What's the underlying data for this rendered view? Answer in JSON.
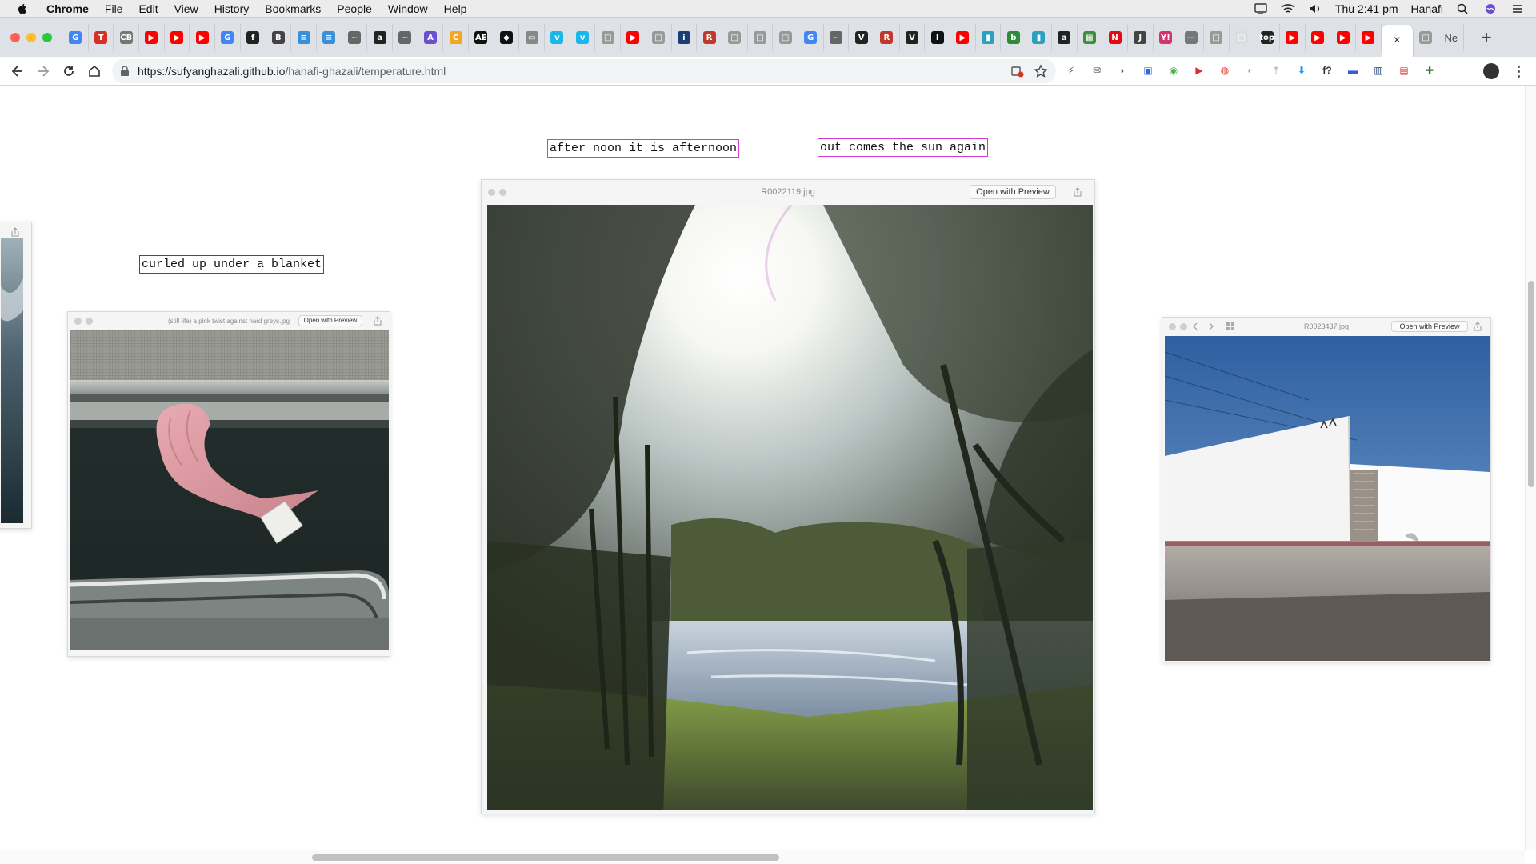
{
  "menubar": {
    "app_name": "Chrome",
    "items": [
      "File",
      "Edit",
      "View",
      "History",
      "Bookmarks",
      "People",
      "Window",
      "Help"
    ],
    "clock": "Thu 2:41 pm",
    "user": "Hanafi"
  },
  "tabs": {
    "favicons": [
      {
        "glyph": "G",
        "color": "#4285f4"
      },
      {
        "glyph": "T",
        "color": "#d93025"
      },
      {
        "glyph": "CB",
        "color": "#777777"
      },
      {
        "glyph": "▶",
        "color": "#ff0000"
      },
      {
        "glyph": "▶",
        "color": "#ff0000"
      },
      {
        "glyph": "▶",
        "color": "#ff0000"
      },
      {
        "glyph": "G",
        "color": "#4285f4"
      },
      {
        "glyph": "f",
        "color": "#222222"
      },
      {
        "glyph": "B",
        "color": "#444444"
      },
      {
        "glyph": "≡",
        "color": "#3a8fd9"
      },
      {
        "glyph": "≡",
        "color": "#3a8fd9"
      },
      {
        "glyph": "~",
        "color": "#666666"
      },
      {
        "glyph": "a",
        "color": "#222222"
      },
      {
        "glyph": "~",
        "color": "#666666"
      },
      {
        "glyph": "A",
        "color": "#6a4fd1"
      },
      {
        "glyph": "C",
        "color": "#f5a623"
      },
      {
        "glyph": "AE",
        "color": "#111111"
      },
      {
        "glyph": "◆",
        "color": "#111111"
      },
      {
        "glyph": "▭",
        "color": "#888888"
      },
      {
        "glyph": "v",
        "color": "#1ab7ea"
      },
      {
        "glyph": "v",
        "color": "#1ab7ea"
      },
      {
        "glyph": "□",
        "color": "#999999"
      },
      {
        "glyph": "▶",
        "color": "#ff0000"
      },
      {
        "glyph": "□",
        "color": "#999999"
      },
      {
        "glyph": "i",
        "color": "#1a3e72"
      },
      {
        "glyph": "R",
        "color": "#c0392b"
      },
      {
        "glyph": "□",
        "color": "#999999"
      },
      {
        "glyph": "□",
        "color": "#999999"
      },
      {
        "glyph": "□",
        "color": "#999999"
      },
      {
        "glyph": "G",
        "color": "#4285f4"
      },
      {
        "glyph": "~",
        "color": "#666666"
      },
      {
        "glyph": "V",
        "color": "#222222"
      },
      {
        "glyph": "R",
        "color": "#c0392b"
      },
      {
        "glyph": "V",
        "color": "#222222"
      },
      {
        "glyph": "I",
        "color": "#111111"
      },
      {
        "glyph": "▶",
        "color": "#ff0000"
      },
      {
        "glyph": "▮",
        "color": "#2aa1c0"
      },
      {
        "glyph": "b",
        "color": "#2e8b3a"
      },
      {
        "glyph": "▮",
        "color": "#2aa1c0"
      },
      {
        "glyph": "a",
        "color": "#222222"
      },
      {
        "glyph": "▦",
        "color": "#3c8d3c"
      },
      {
        "glyph": "N",
        "color": "#e50914"
      },
      {
        "glyph": "J",
        "color": "#444444"
      },
      {
        "glyph": "Y!",
        "color": "#d6336c"
      },
      {
        "glyph": "—",
        "color": "#777777"
      },
      {
        "glyph": "□",
        "color": "#999999"
      },
      {
        "glyph": "□",
        "color": "#dddddd"
      },
      {
        "glyph": "top",
        "color": "#222222"
      },
      {
        "glyph": "▶",
        "color": "#ff0000"
      },
      {
        "glyph": "▶",
        "color": "#ff0000"
      },
      {
        "glyph": "▶",
        "color": "#ff0000"
      },
      {
        "glyph": "▶",
        "color": "#ff0000"
      }
    ],
    "active_close": "×",
    "after_active": [
      {
        "glyph": "□",
        "color": "#999999"
      }
    ],
    "last_tab_title": "Ne",
    "new_tab": "+"
  },
  "toolbar": {
    "url_host": "https://sufyanghazali.github.io",
    "url_path": "/hanafi-ghazali/temperature.html",
    "extensions": [
      {
        "glyph": "⚡",
        "color": "#444444"
      },
      {
        "glyph": "✉",
        "color": "#555555"
      },
      {
        "glyph": "◗",
        "color": "#555555"
      },
      {
        "glyph": "▣",
        "color": "#2d6cdf"
      },
      {
        "glyph": "◉",
        "color": "#4caf50"
      },
      {
        "glyph": "▶",
        "color": "#d32f2f"
      },
      {
        "glyph": "◍",
        "color": "#e53935"
      },
      {
        "glyph": "◐",
        "color": "#9e9e9e"
      },
      {
        "glyph": "⇡",
        "color": "#bdbdbd"
      },
      {
        "glyph": "⬇",
        "color": "#2196f3"
      },
      {
        "glyph": "f?",
        "color": "#333333"
      },
      {
        "glyph": "▬",
        "color": "#3b5bdb"
      },
      {
        "glyph": "▥",
        "color": "#1a3e72"
      },
      {
        "glyph": "▤",
        "color": "#e53935"
      },
      {
        "glyph": "✚",
        "color": "#2e7d32"
      }
    ]
  },
  "page": {
    "captions": {
      "afternoon": "after noon it is afternoon",
      "sun": "out comes the sun again",
      "blanket": "curled up under a blanket"
    },
    "windows": {
      "left": {
        "title": "(still life) a pink twist against hard greys.jpg",
        "open_label": "Open with Preview"
      },
      "center": {
        "title": "R0022119.jpg",
        "open_label": "Open with Preview"
      },
      "right": {
        "title": "R0023437.jpg",
        "open_label": "Open with Preview"
      }
    }
  }
}
